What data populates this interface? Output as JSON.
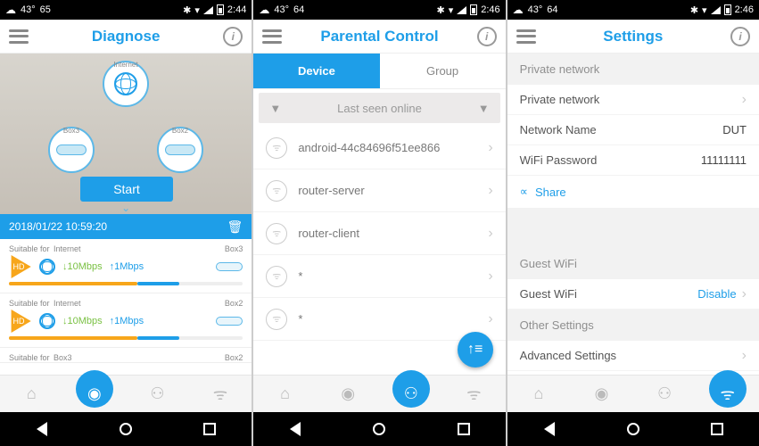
{
  "status": {
    "temp1": "43°",
    "extra1": "65",
    "extra2": "64",
    "time1": "2:44",
    "time2": "2:46",
    "time3": "2:46"
  },
  "diagnose": {
    "title": "Diagnose",
    "nodes": {
      "internet": "Internet",
      "box3": "Box3",
      "box2": "Box2"
    },
    "start": "Start",
    "timestamp": "2018/01/22 10:59:20",
    "suitable": "Suitable for",
    "hd": "HD",
    "internet_label": "Internet",
    "down1": "10Mbps",
    "up1": "1Mbps",
    "down2": "10Mbps",
    "up2": "1Mbps",
    "box3_label": "Box3",
    "box2_label": "Box2"
  },
  "parental": {
    "title": "Parental Control",
    "tab_device": "Device",
    "tab_group": "Group",
    "filter_label": "Last seen online",
    "devices": [
      "android-44c84696f51ee866",
      "router-server",
      "router-client",
      "*",
      "*"
    ]
  },
  "settings": {
    "title": "Settings",
    "private_header": "Private network",
    "private_network": "Private network",
    "network_name_label": "Network Name",
    "network_name_value": "DUT",
    "wifi_pwd_label": "WiFi Password",
    "wifi_pwd_value": "11111111",
    "share": "Share",
    "guest_header": "Guest WiFi",
    "guest_label": "Guest WiFi",
    "guest_value": "Disable",
    "other_header": "Other Settings",
    "advanced": "Advanced Settings"
  }
}
